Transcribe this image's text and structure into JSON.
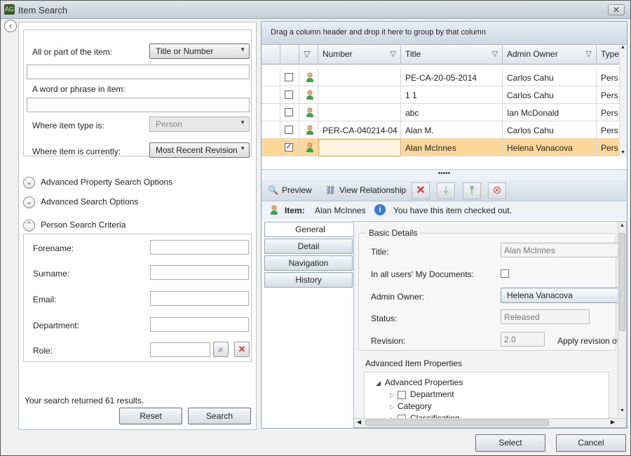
{
  "window": {
    "title": "Item Search",
    "app_icon": "AG",
    "close_glyph": "✕"
  },
  "search": {
    "all_or_part_label": "All or part of the item:",
    "title_or_number": "Title or Number",
    "word_phrase_label": "A word or phrase in item:",
    "item_type_label": "Where item type is:",
    "item_type_value": "Person",
    "item_currently_label": "Where item is currently:",
    "item_currently_value": "Most Recent Revision"
  },
  "sections": {
    "advanced_property": "Advanced Property Search Options",
    "advanced_search": "Advanced Search Options",
    "person_criteria": "Person Search Criteria"
  },
  "person_fields": {
    "forename": "Forename:",
    "surname": "Surname:",
    "email": "Email:",
    "department": "Department:",
    "role": "Role:"
  },
  "results_text": "Your search returned 61 results.",
  "buttons": {
    "reset": "Reset",
    "search": "Search",
    "select": "Select",
    "cancel": "Cancel"
  },
  "grid": {
    "group_hint": "Drag a column header and drop it here to group by that column",
    "columns": [
      "Number",
      "Title",
      "Admin Owner",
      "Type"
    ],
    "rows": [
      {
        "number": "",
        "title": "PE-CA-20-05-2014",
        "owner": "Carlos Cahu",
        "type": "Pers",
        "checked": false
      },
      {
        "number": "",
        "title": "1 1",
        "owner": "Carlos Cahu",
        "type": "Pers",
        "checked": false
      },
      {
        "number": "",
        "title": "abc",
        "owner": "Ian McDonald",
        "type": "Pers",
        "checked": false
      },
      {
        "number": "PER-CA-040214-04",
        "title": "Alan M.",
        "owner": "Carlos Cahu",
        "type": "Pers",
        "checked": false
      },
      {
        "number": "",
        "title": "Alan McInnes",
        "owner": "Helena Vanacova",
        "type": "Pers",
        "checked": true
      }
    ]
  },
  "splitter_glyph": "•••••",
  "toolbar": {
    "preview": "Preview",
    "view_relationship": "View Relationship"
  },
  "itembar": {
    "item_label": "Item:",
    "item_value": "Alan McInnes",
    "checked_out_msg": "You have this item checked out."
  },
  "tabs": [
    "General",
    "Detail",
    "Navigation",
    "History"
  ],
  "basic_details": {
    "legend": "Basic Details",
    "title_label": "Title:",
    "title_value": "Alan McInnes",
    "my_docs_label": "In all users' My Documents:",
    "admin_owner_label": "Admin Owner:",
    "admin_owner_value": "Helena Vanacova",
    "status_label": "Status:",
    "status_value": "Released",
    "revision_label": "Revision:",
    "revision_value": "2.0",
    "apply_revision": "Apply revision off"
  },
  "advanced_item_props": {
    "legend": "Advanced Item Properties",
    "tree": [
      "Advanced Properties",
      "Department",
      "Category",
      "Classification"
    ]
  }
}
